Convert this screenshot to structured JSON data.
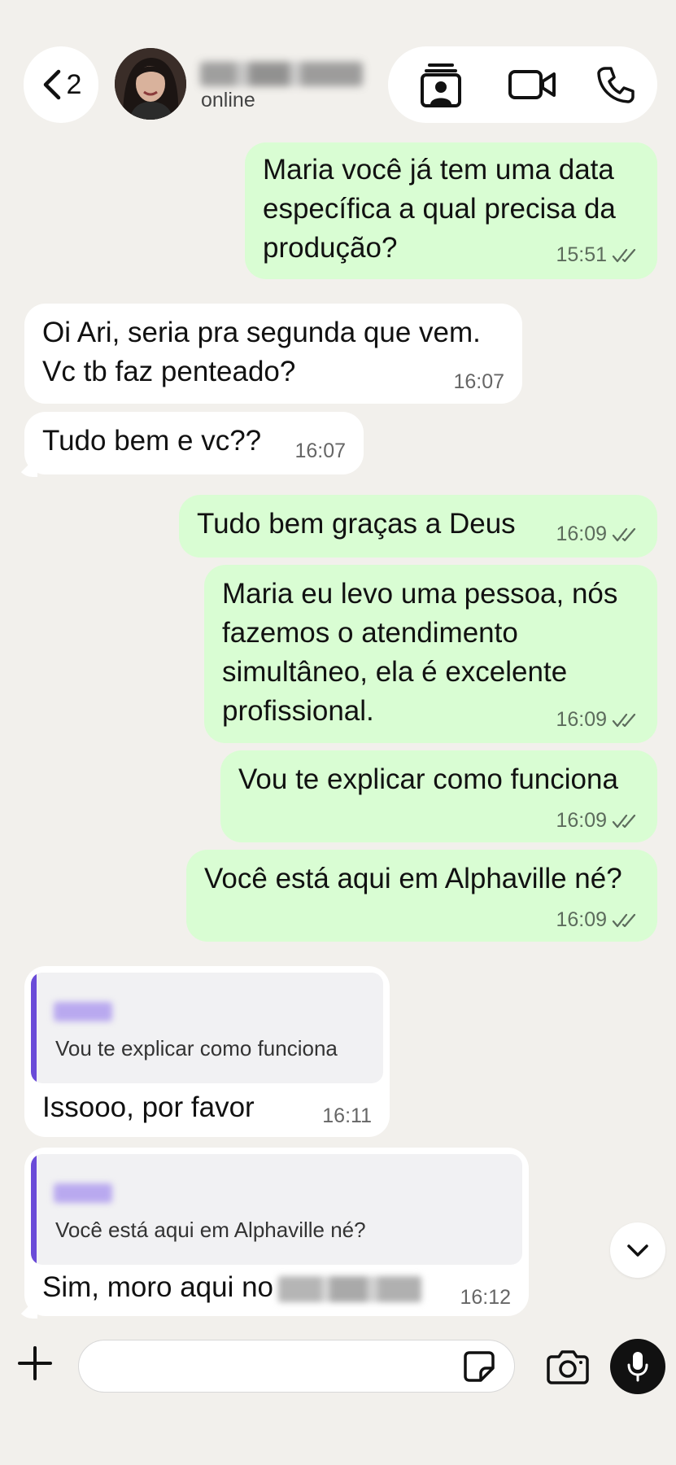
{
  "header": {
    "back_count": "2",
    "contact_status": "online",
    "icons": [
      "chevron-left-icon",
      "contact-card-icon",
      "video-call-icon",
      "phone-icon"
    ]
  },
  "messages": [
    {
      "dir": "out",
      "text": "Maria você já tem uma data\nespecífica a qual precisa da\nprodução?",
      "time": "15:51",
      "read": true
    },
    {
      "dir": "in",
      "text": "Oi Ari, seria pra segunda que vem.\nVc tb faz penteado?",
      "time": "16:07"
    },
    {
      "dir": "in",
      "text": "Tudo bem e vc??",
      "time": "16:07"
    },
    {
      "dir": "out",
      "text": "Tudo bem graças a Deus",
      "time": "16:09",
      "read": true
    },
    {
      "dir": "out",
      "text": "Maria eu levo uma pessoa, nós\nfazemos o atendimento\nsimultâneo, ela é excelente\nprofissional.",
      "time": "16:09",
      "read": true
    },
    {
      "dir": "out",
      "text": "Vou te explicar como funciona",
      "time": "16:09",
      "read": true
    },
    {
      "dir": "out",
      "text": "Você está aqui em Alphaville né?",
      "time": "16:09",
      "read": true
    },
    {
      "dir": "in",
      "quote": "Vou te explicar como funciona",
      "text": "Issooo, por favor",
      "time": "16:11"
    },
    {
      "dir": "in",
      "quote": "Você está aqui em Alphaville né?",
      "text": "Sim, moro aqui no",
      "time": "16:12"
    }
  ],
  "composer": {
    "input_value": "",
    "icons": [
      "plus-icon",
      "sticker-icon",
      "camera-icon",
      "microphone-icon"
    ]
  },
  "colors": {
    "background": "#f2f0ec",
    "outgoing_bubble": "#d9fdd3",
    "incoming_bubble": "#ffffff",
    "quote_bar": "#6a4bd8"
  }
}
